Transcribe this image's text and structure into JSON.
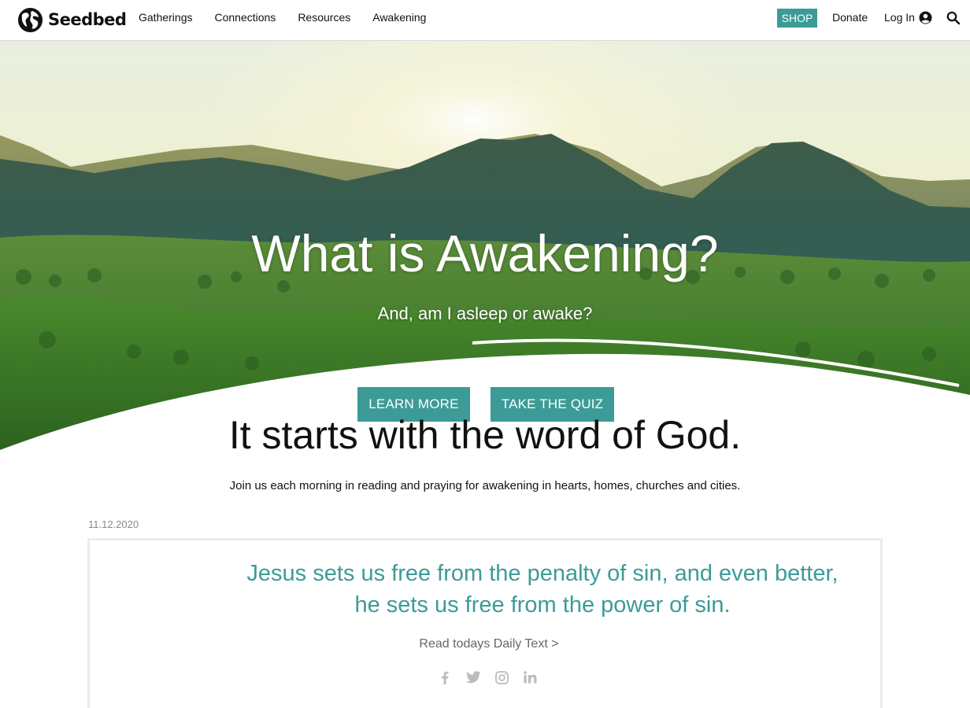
{
  "header": {
    "brand": "Seedbed",
    "nav": [
      "Gatherings",
      "Connections",
      "Resources",
      "Awakening"
    ],
    "shop_label": "SHOP",
    "donate_label": "Donate",
    "login_label": "Log In"
  },
  "hero": {
    "title": "What is Awakening?",
    "subtitle": "And, am I asleep or awake?",
    "learn_more_label": "LEARN MORE",
    "quiz_label": "TAKE THE QUIZ"
  },
  "content": {
    "headline": "It starts with the word of God.",
    "intro": "Join us each morning in reading and praying for awakening in hearts, homes, churches and cities.",
    "date": "11.12.2020",
    "quote_line1": "Jesus sets us free from the penalty of sin, and even better,",
    "quote_line2": "he sets us free from the power of sin.",
    "read_link": "Read todays Daily Text >",
    "social_icons": [
      "facebook-icon",
      "twitter-icon",
      "instagram-icon",
      "linkedin-icon"
    ]
  },
  "colors": {
    "accent": "#3c9b97",
    "text": "#111111",
    "muted": "#888888"
  }
}
